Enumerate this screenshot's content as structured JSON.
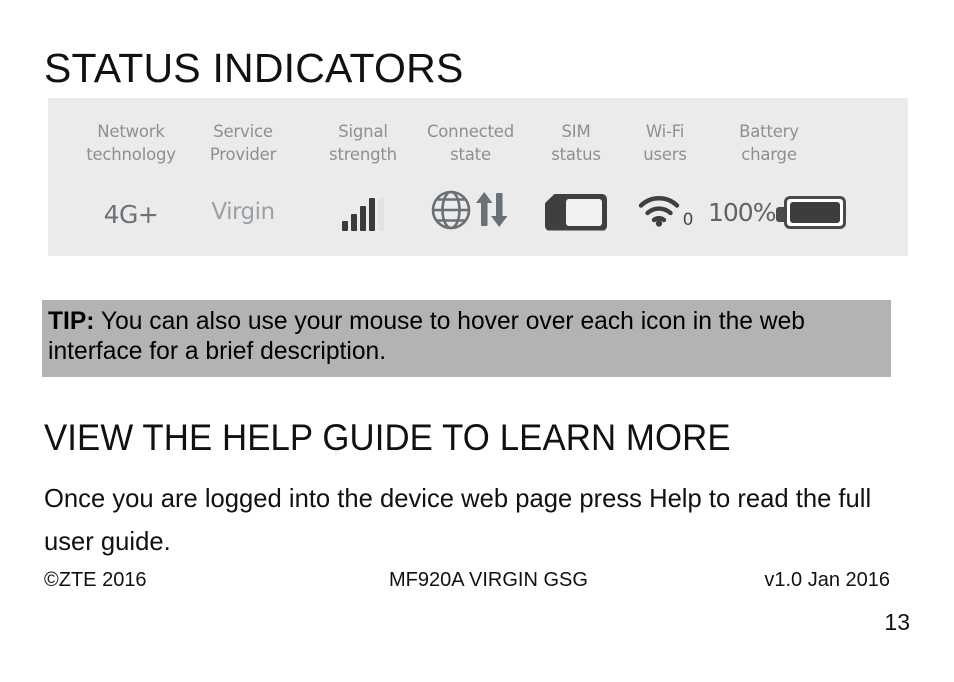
{
  "slide": {
    "heading_status": "STATUS INDICATORS",
    "heading_help": "VIEW THE HELP GUIDE TO LEARN MORE",
    "help_body": "Once you are logged into the device web page press Help to read the full user guide."
  },
  "status_panel": {
    "background_color": "#ebebeb",
    "header_text_color": "#8b9095",
    "columns": [
      {
        "header_line1": "Network",
        "header_line2": "technology",
        "value": "4G+",
        "icon": "network-technology-text"
      },
      {
        "header_line1": "Service",
        "header_line2": "Provider",
        "value": "Virgin",
        "icon": "service-provider-text"
      },
      {
        "header_line1": "Signal",
        "header_line2": "strength",
        "value": "",
        "icon": "signal-bars-icon"
      },
      {
        "header_line1": "Connected",
        "header_line2": "state",
        "value": "",
        "icon": "globe-updown-arrows-icon"
      },
      {
        "header_line1": "SIM",
        "header_line2": "status",
        "value": "",
        "icon": "sim-card-icon"
      },
      {
        "header_line1": "Wi-Fi",
        "header_line2": "users",
        "value": "0",
        "icon": "wifi-icon"
      },
      {
        "header_line1": "Battery",
        "header_line2": "charge",
        "value": "100%",
        "icon": "battery-full-icon"
      }
    ]
  },
  "tip": {
    "label": "TIP:",
    "text": " You can also use your mouse to hover over each icon in the web interface for a brief description.",
    "background_color": "#b3b3b3"
  },
  "footer": {
    "copyright": "©ZTE 2016",
    "document": "MF920A VIRGIN GSG",
    "version": "v1.0 Jan 2016",
    "page_number": "13"
  }
}
